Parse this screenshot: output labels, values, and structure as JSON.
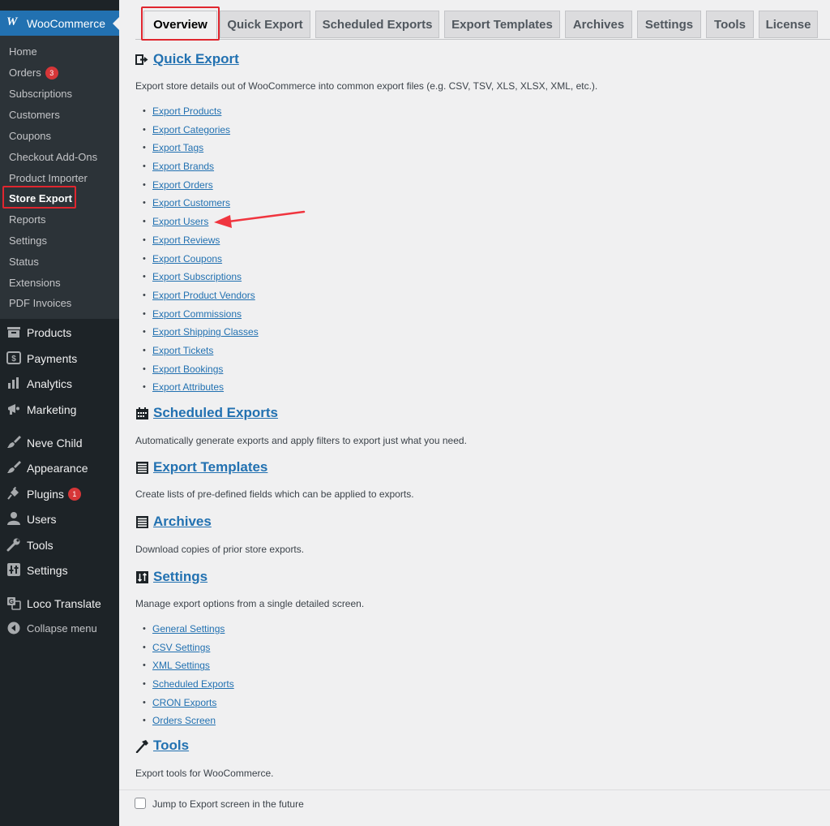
{
  "sidebar": {
    "header_label": "WooCommerce",
    "header_logo": "W",
    "submenu": [
      {
        "label": "Home"
      },
      {
        "label": "Orders",
        "badge": "3"
      },
      {
        "label": "Subscriptions"
      },
      {
        "label": "Customers"
      },
      {
        "label": "Coupons"
      },
      {
        "label": "Checkout Add-Ons"
      },
      {
        "label": "Product Importer"
      },
      {
        "label": "Store Export",
        "active": true
      },
      {
        "label": "Reports"
      },
      {
        "label": "Settings"
      },
      {
        "label": "Status"
      },
      {
        "label": "Extensions"
      },
      {
        "label": "PDF Invoices"
      }
    ],
    "menu": [
      {
        "label": "Products",
        "icon": "products-icon"
      },
      {
        "label": "Payments",
        "icon": "payments-icon"
      },
      {
        "label": "Analytics",
        "icon": "analytics-icon"
      },
      {
        "label": "Marketing",
        "icon": "megaphone-icon"
      },
      {
        "label": "Neve Child",
        "icon": "brush-icon"
      },
      {
        "label": "Appearance",
        "icon": "brush-icon"
      },
      {
        "label": "Plugins",
        "icon": "plugin-icon",
        "badge": "1"
      },
      {
        "label": "Users",
        "icon": "user-icon"
      },
      {
        "label": "Tools",
        "icon": "wrench-icon"
      },
      {
        "label": "Settings",
        "icon": "settings-icon"
      },
      {
        "label": "Loco Translate",
        "icon": "translate-icon"
      },
      {
        "label": "Collapse menu",
        "icon": "collapse-icon"
      }
    ]
  },
  "tabs": [
    {
      "label": "Overview",
      "active": true
    },
    {
      "label": "Quick Export"
    },
    {
      "label": "Scheduled Exports"
    },
    {
      "label": "Export Templates"
    },
    {
      "label": "Archives"
    },
    {
      "label": "Settings"
    },
    {
      "label": "Tools"
    },
    {
      "label": "License"
    }
  ],
  "sections": {
    "quick_export": {
      "title": "Quick Export",
      "icon": "export-icon",
      "description": "Export store details out of WooCommerce into common export files (e.g. CSV, TSV, XLS, XLSX, XML, etc.).",
      "links": [
        "Export Products",
        "Export Categories",
        "Export Tags",
        "Export Brands",
        "Export Orders",
        "Export Customers",
        "Export Users",
        "Export Reviews",
        "Export Coupons",
        "Export Subscriptions",
        "Export Product Vendors",
        "Export Commissions",
        "Export Shipping Classes",
        "Export Tickets",
        "Export Bookings",
        "Export Attributes"
      ]
    },
    "scheduled_exports": {
      "title": "Scheduled Exports",
      "icon": "calendar-icon",
      "description": "Automatically generate exports and apply filters to export just what you need."
    },
    "export_templates": {
      "title": "Export Templates",
      "icon": "list-icon",
      "description": "Create lists of pre-defined fields which can be applied to exports."
    },
    "archives": {
      "title": "Archives",
      "icon": "list-icon",
      "description": "Download copies of prior store exports."
    },
    "settings": {
      "title": "Settings",
      "icon": "sort-icon",
      "description": "Manage export options from a single detailed screen.",
      "links": [
        "General Settings",
        "CSV Settings",
        "XML Settings",
        "Scheduled Exports",
        "CRON Exports",
        "Orders Screen"
      ]
    },
    "tools": {
      "title": "Tools",
      "icon": "hammer-icon",
      "description": "Export tools for WooCommerce."
    }
  },
  "footer": {
    "checkbox_label": "Jump to Export screen in the future",
    "checked": false
  },
  "colors": {
    "sidebar_bg": "#1d2327",
    "submenu_bg": "#2c3338",
    "accent": "#2271b1",
    "highlight": "#e0262f",
    "badge": "#d63638"
  }
}
